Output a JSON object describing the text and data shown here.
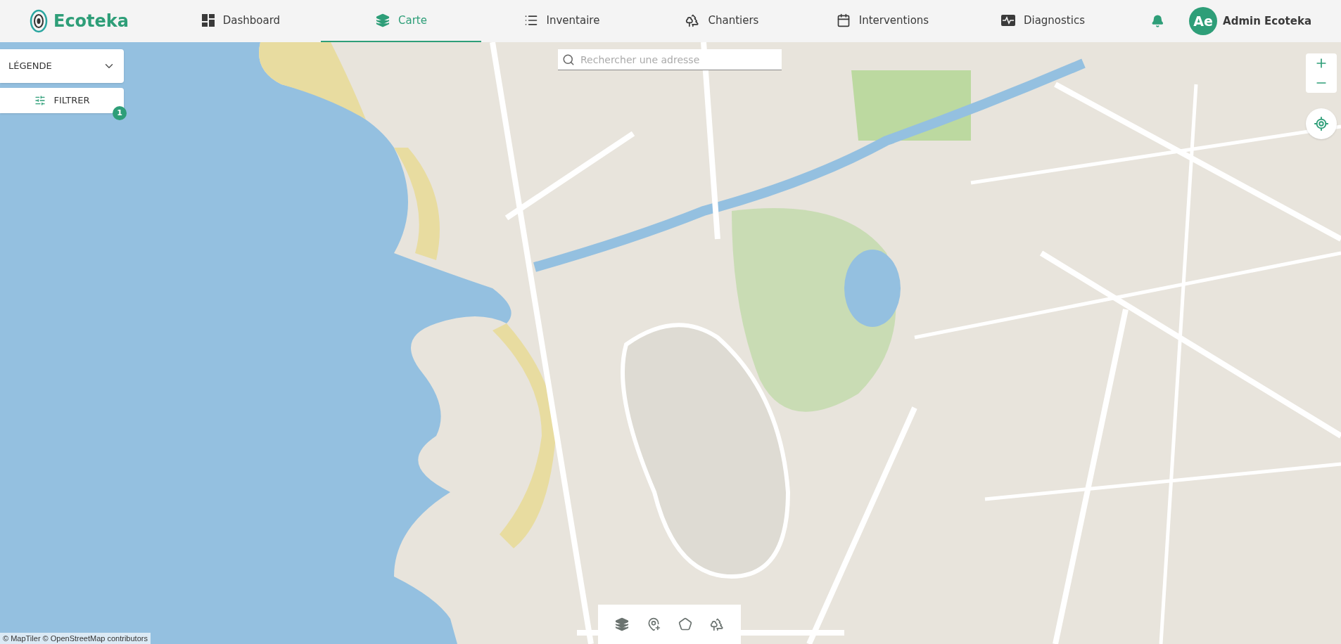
{
  "app": {
    "name": "Ecoteka"
  },
  "nav": [
    {
      "label": "Dashboard",
      "selected": false
    },
    {
      "label": "Carte",
      "selected": true
    },
    {
      "label": "Inventaire",
      "selected": false
    },
    {
      "label": "Chantiers",
      "selected": false
    },
    {
      "label": "Interventions",
      "selected": false
    },
    {
      "label": "Diagnostics",
      "selected": false
    }
  ],
  "user": {
    "initials": "Ae",
    "name": "Admin Ecoteka"
  },
  "legend": {
    "label": "LÉGENDE"
  },
  "filter": {
    "label": "FILTRER",
    "badge": "1"
  },
  "search": {
    "placeholder": "Rechercher une adresse"
  },
  "attribution": "© MapTiler © OpenStreetMap contributors"
}
